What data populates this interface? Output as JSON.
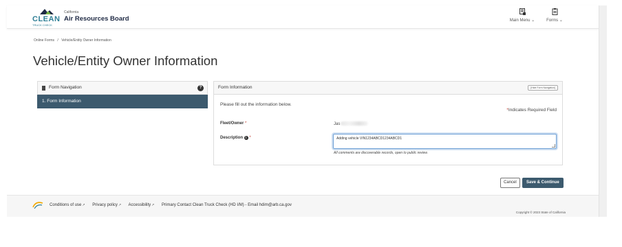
{
  "header": {
    "logo_text": "CLEAN",
    "logo_subtext": "TRUCK CHECK",
    "org_small": "California",
    "org_title": "Air Resources Board",
    "nav": [
      {
        "label": "Main Menu",
        "icon": "main-menu-icon"
      },
      {
        "label": "Forms",
        "icon": "forms-icon"
      }
    ]
  },
  "breadcrumb": {
    "items": [
      "Online Forms",
      "/",
      "Vehicle/Entity Owner Information"
    ]
  },
  "page": {
    "title": "Vehicle/Entity Owner Information"
  },
  "form_navigation": {
    "title": "Form Navigation",
    "help_icon": "question-icon",
    "items": [
      {
        "label": "1. Form Information",
        "active": true
      }
    ]
  },
  "form": {
    "title": "Form Information",
    "hide_nav_label": "[Hide Form Navigation]",
    "instructions": "Please fill out the information below.",
    "required_marker": "*",
    "required_note": "Indicates Required Field",
    "fields": {
      "fleet_owner": {
        "label": "Fleet/Owner",
        "value": "Jas"
      },
      "description": {
        "label": "Description",
        "value": "Adding vehicle VIN1234ABCD1234ABCD1",
        "help": "All comments are discoverable records, open to public review."
      }
    }
  },
  "actions": {
    "cancel_label": "Cancel",
    "save_label": "Save & Continue"
  },
  "footer": {
    "links": [
      {
        "label": "Conditions of use"
      },
      {
        "label": "Privacy policy"
      },
      {
        "label": "Accessibility"
      }
    ],
    "contact": "Primary Contact Clean Truck Check (HD I/M) - Email hdim@arb.ca.gov",
    "copyright": "Copyright © 2023 State of California"
  },
  "colors": {
    "brand_teal": "#2f7f96",
    "nav_active_bg": "#3c5a6e",
    "primary_button": "#3c5a6e",
    "required_star": "#c0392b",
    "focus_border": "#6fa1d6"
  }
}
